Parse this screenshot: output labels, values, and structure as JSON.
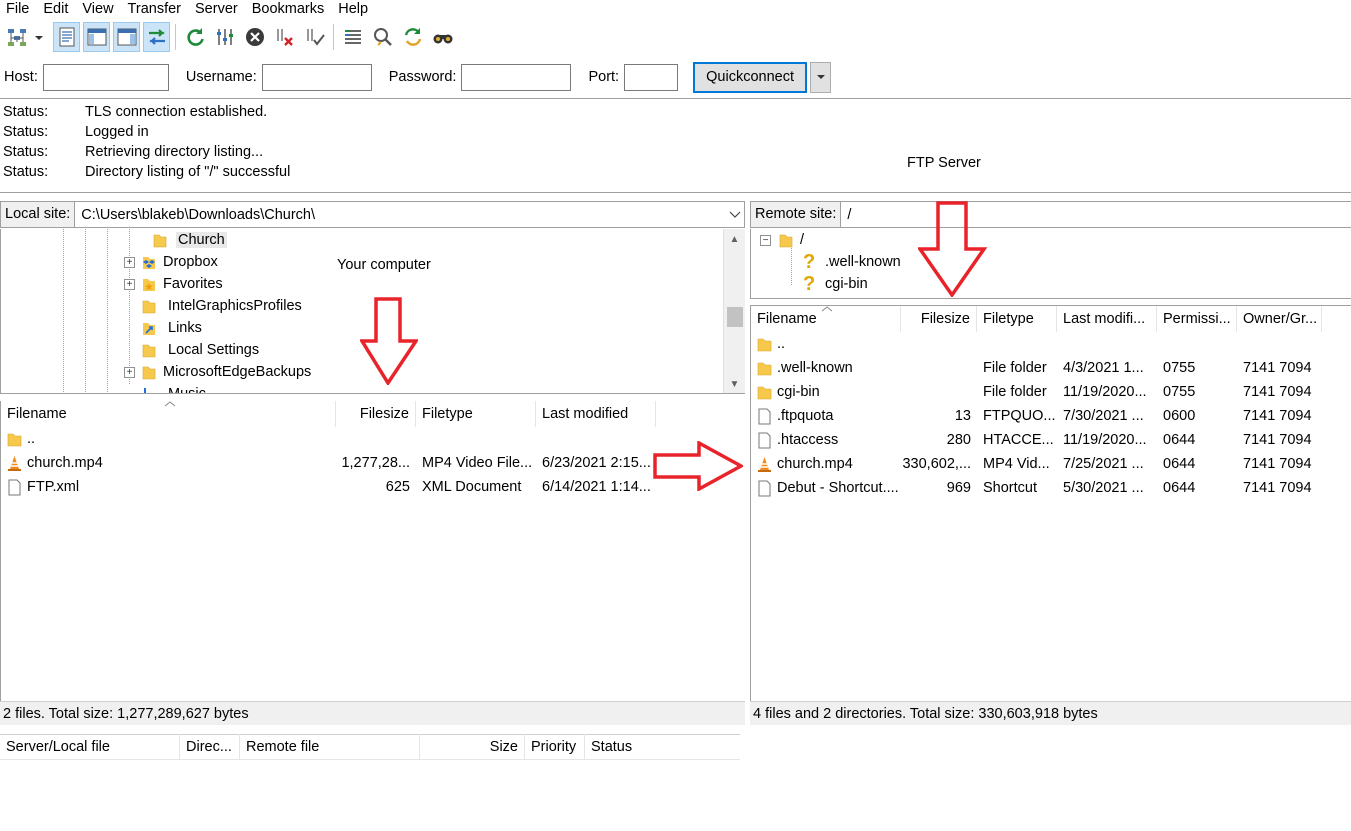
{
  "menubar": {
    "items": [
      "File",
      "Edit",
      "View",
      "Transfer",
      "Server",
      "Bookmarks",
      "Help"
    ]
  },
  "toolbar": {
    "icons": [
      "site-manager-icon",
      "dropdown-arrow-icon",
      "toggle-message-log-icon",
      "toggle-local-tree-icon",
      "toggle-remote-tree-icon",
      "toggle-transfer-queue-icon",
      "refresh-icon",
      "process-queue-icon",
      "cancel-icon",
      "disconnect-icon",
      "reconnect-icon",
      "directory-filter-icon",
      "toggle-filter-icon",
      "sync-browse-icon",
      "search-icon"
    ]
  },
  "quickconnect": {
    "host_label": "Host:",
    "host_value": "",
    "username_label": "Username:",
    "username_value": "",
    "password_label": "Password:",
    "password_value": "",
    "port_label": "Port:",
    "port_value": "",
    "button_label": "Quickconnect"
  },
  "log": {
    "entries": [
      {
        "key": "Status:",
        "text": "TLS connection established."
      },
      {
        "key": "Status:",
        "text": "Logged in"
      },
      {
        "key": "Status:",
        "text": "Retrieving directory listing..."
      },
      {
        "key": "Status:",
        "text": "Directory listing of \"/\" successful"
      }
    ]
  },
  "annotations": {
    "ftp_server": "FTP Server",
    "your_computer": "Your computer"
  },
  "local": {
    "site_label": "Local site:",
    "path": "C:\\Users\\blakeb\\Downloads\\Church\\",
    "tree": [
      {
        "label": "Church",
        "expander": false
      },
      {
        "label": "Dropbox",
        "expander": true
      },
      {
        "label": "Favorites",
        "expander": true
      },
      {
        "label": "IntelGraphicsProfiles",
        "expander": false
      },
      {
        "label": "Links",
        "expander": false
      },
      {
        "label": "Local Settings",
        "expander": false
      },
      {
        "label": "MicrosoftEdgeBackups",
        "expander": true
      },
      {
        "label": "Music",
        "expander": false
      }
    ],
    "columns": [
      "Filename",
      "Filesize",
      "Filetype",
      "Last modified"
    ],
    "files": [
      {
        "name": "..",
        "size": "",
        "type": "",
        "modified": "",
        "icon": "folder-icon"
      },
      {
        "name": "church.mp4",
        "size": "1,277,28...",
        "type": "MP4 Video File...",
        "modified": "6/23/2021 2:15...",
        "icon": "vlc-cone-icon"
      },
      {
        "name": "FTP.xml",
        "size": "625",
        "type": "XML Document",
        "modified": "6/14/2021 1:14...",
        "icon": "document-icon"
      }
    ],
    "status": "2 files. Total size: 1,277,289,627 bytes"
  },
  "remote": {
    "site_label": "Remote site:",
    "path": "/",
    "tree": [
      {
        "label": "/",
        "icon": "folder-icon"
      },
      {
        "label": ".well-known",
        "icon": "question-icon"
      },
      {
        "label": "cgi-bin",
        "icon": "question-icon"
      }
    ],
    "columns": [
      "Filename",
      "Filesize",
      "Filetype",
      "Last modifi...",
      "Permissi...",
      "Owner/Gr..."
    ],
    "files": [
      {
        "name": "..",
        "size": "",
        "type": "",
        "modified": "",
        "perms": "",
        "owner": "",
        "icon": "folder-icon"
      },
      {
        "name": ".well-known",
        "size": "",
        "type": "File folder",
        "modified": "4/3/2021 1...",
        "perms": "0755",
        "owner": "7141 7094",
        "icon": "folder-icon"
      },
      {
        "name": "cgi-bin",
        "size": "",
        "type": "File folder",
        "modified": "11/19/2020...",
        "perms": "0755",
        "owner": "7141 7094",
        "icon": "folder-icon"
      },
      {
        "name": ".ftpquota",
        "size": "13",
        "type": "FTPQUO...",
        "modified": "7/30/2021 ...",
        "perms": "0600",
        "owner": "7141 7094",
        "icon": "document-icon"
      },
      {
        "name": ".htaccess",
        "size": "280",
        "type": "HTACCE...",
        "modified": "11/19/2020...",
        "perms": "0644",
        "owner": "7141 7094",
        "icon": "document-icon"
      },
      {
        "name": "church.mp4",
        "size": "330,602,...",
        "type": "MP4 Vid...",
        "modified": "7/25/2021 ...",
        "perms": "0644",
        "owner": "7141 7094",
        "icon": "vlc-cone-icon"
      },
      {
        "name": "Debut - Shortcut....",
        "size": "969",
        "type": "Shortcut",
        "modified": "5/30/2021 ...",
        "perms": "0644",
        "owner": "7141 7094",
        "icon": "document-icon"
      }
    ],
    "status": "4 files and 2 directories. Total size: 330,603,918 bytes"
  },
  "queue": {
    "columns": [
      "Server/Local file",
      "Direc...",
      "Remote file",
      "Size",
      "Priority",
      "Status"
    ]
  },
  "colors": {
    "arrow": "#e8232a",
    "folder": "#f6c84c",
    "selection": "#cce4f7",
    "accent": "#0078d7"
  }
}
